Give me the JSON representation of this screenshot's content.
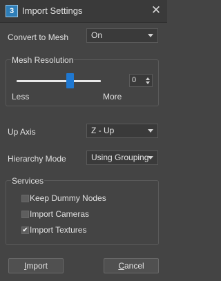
{
  "window": {
    "title": "Import Settings",
    "app_icon_text": "3"
  },
  "convert_to_mesh": {
    "label": "Convert to Mesh",
    "value": "On"
  },
  "mesh_resolution": {
    "group_title": "Mesh Resolution",
    "min_label": "Less",
    "max_label": "More",
    "value": "0",
    "slider_fraction": 0.6
  },
  "up_axis": {
    "label": "Up Axis",
    "value": "Z - Up"
  },
  "hierarchy_mode": {
    "label": "Hierarchy Mode",
    "value": "Using Grouping"
  },
  "services": {
    "group_title": "Services",
    "options": [
      {
        "label": "Keep Dummy Nodes",
        "checked": false
      },
      {
        "label": "Import Cameras",
        "checked": false
      },
      {
        "label": "Import Textures",
        "checked": true
      }
    ]
  },
  "buttons": {
    "import": {
      "first": "I",
      "rest": "mport"
    },
    "cancel": {
      "first": "C",
      "rest": "ancel"
    }
  },
  "colors": {
    "accent": "#1f78d1",
    "background": "#444444",
    "titlebar": "#3a3a3a"
  }
}
